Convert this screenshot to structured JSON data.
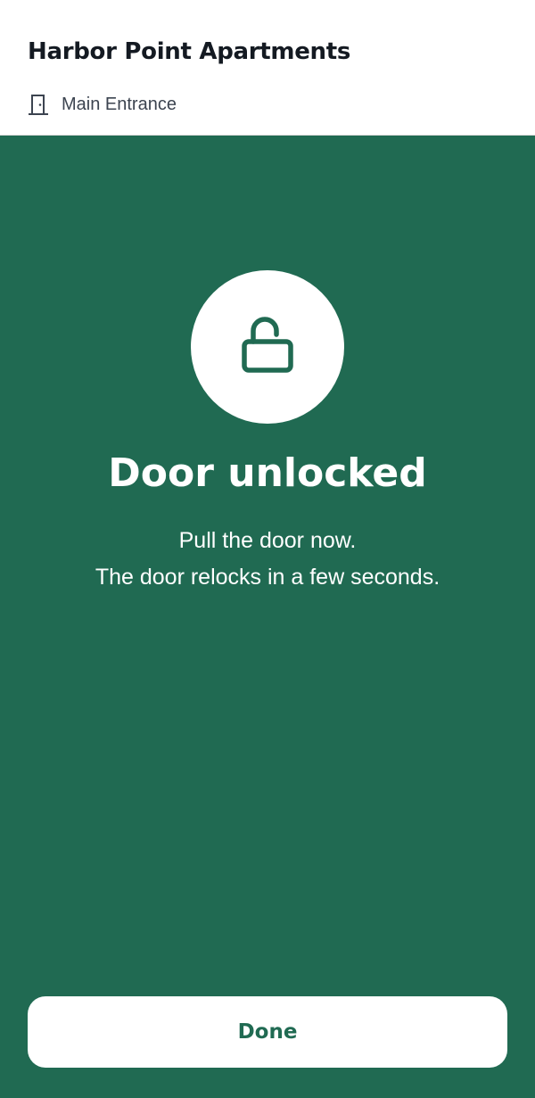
{
  "header": {
    "title": "Harbor Point Apartments",
    "entrance": {
      "icon": "door-icon",
      "label": "Main Entrance"
    }
  },
  "status": {
    "icon": "unlocked-padlock-icon",
    "title": "Door unlocked",
    "line_1": "Pull the door now.",
    "line_2": "The door relocks in a few seconds."
  },
  "actions": {
    "done_label": "Done"
  },
  "colors": {
    "accent_green": "#206a52",
    "header_text": "#141a22",
    "secondary_text": "#3c4450",
    "surface": "#ffffff"
  }
}
